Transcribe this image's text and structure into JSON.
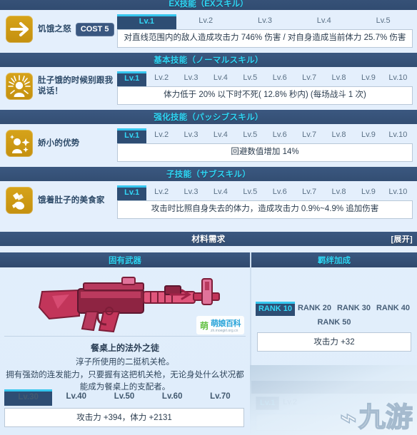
{
  "sections": {
    "ex": {
      "title": "EX技能（EXスキル）",
      "skill": {
        "icon": "arrow-right-icon",
        "name": "饥饿之怒",
        "cost": "COST 5",
        "tabs": [
          "Lv.1",
          "Lv.2",
          "Lv.3",
          "Lv.4",
          "Lv.5"
        ],
        "active_tab": 0,
        "description": "对直线范围内的敌人造成攻击力 746% 伤害 / 对自身造成当前体力 25.7% 伤害"
      }
    },
    "normal": {
      "title": "基本技能（ノーマルスキル）",
      "skill": {
        "icon": "radiant-figure-icon",
        "name": "肚子饿的时候别跟我说话！",
        "tabs": [
          "Lv.1",
          "Lv.2",
          "Lv.3",
          "Lv.4",
          "Lv.5",
          "Lv.6",
          "Lv.7",
          "Lv.8",
          "Lv.9",
          "Lv.10"
        ],
        "active_tab": 0,
        "description": "体力低于 20% 以下时不死( 12.8% 秒内) (每场战斗 1 次)"
      }
    },
    "passive": {
      "title": "强化技能（パッシブスキル）",
      "skill": {
        "icon": "sparkle-figure-icon",
        "name": "娇小的优势",
        "tabs": [
          "Lv.1",
          "Lv.2",
          "Lv.3",
          "Lv.4",
          "Lv.5",
          "Lv.6",
          "Lv.7",
          "Lv.8",
          "Lv.9",
          "Lv.10"
        ],
        "active_tab": 0,
        "description": "回避数值增加 14%"
      }
    },
    "sub": {
      "title": "子技能（サブスキル）",
      "skill": {
        "icon": "bullets-icon",
        "name": "饿着肚子的美食家",
        "tabs": [
          "Lv.1",
          "Lv.2",
          "Lv.3",
          "Lv.4",
          "Lv.5",
          "Lv.6",
          "Lv.7",
          "Lv.8",
          "Lv.9",
          "Lv.10"
        ],
        "active_tab": 0,
        "description": "攻击时比照自身失去的体力，造成攻击力 0.9%~4.9% 追加伤害"
      }
    },
    "materials": {
      "title": "材料需求",
      "expand_label": "[展开]"
    }
  },
  "weapon": {
    "header": "固有武器",
    "art_icon": "pink-assault-rifle-icon",
    "name": "餐桌上的法外之徒",
    "subtitle": "淳子所使用的二挺机关枪。",
    "description": "拥有强劲的连发能力，只要握有这把机关枪，无论身处什么状况都能成为餐桌上的支配者。",
    "tabs": [
      "Lv.30",
      "Lv.40",
      "Lv.50",
      "Lv.60",
      "Lv.70"
    ],
    "active_tab": 0,
    "stats": "攻击力 +394，体力 +2131"
  },
  "bond": {
    "header": "羁绊加成",
    "tabs": [
      "RANK 10",
      "RANK 20",
      "RANK 30",
      "RANK 40",
      "RANK 50"
    ],
    "active_tab": 0,
    "stats": "攻击力 +32",
    "mini_tabs": [
      "Lv.1",
      "Lv.2"
    ],
    "mini_active_tab": 0
  },
  "watermark": {
    "brand_cn": "萌娘百科",
    "brand_url": "zh.moegirl.org.cn",
    "brand_mark": "萌",
    "site_mark": "九游"
  },
  "colors": {
    "accent_cyan": "#33d8f7",
    "header_navy": "#3b5880",
    "tab_active": "#2e4d73",
    "icon_gold": "#d6a31a",
    "page_bg": "#e4effc"
  }
}
